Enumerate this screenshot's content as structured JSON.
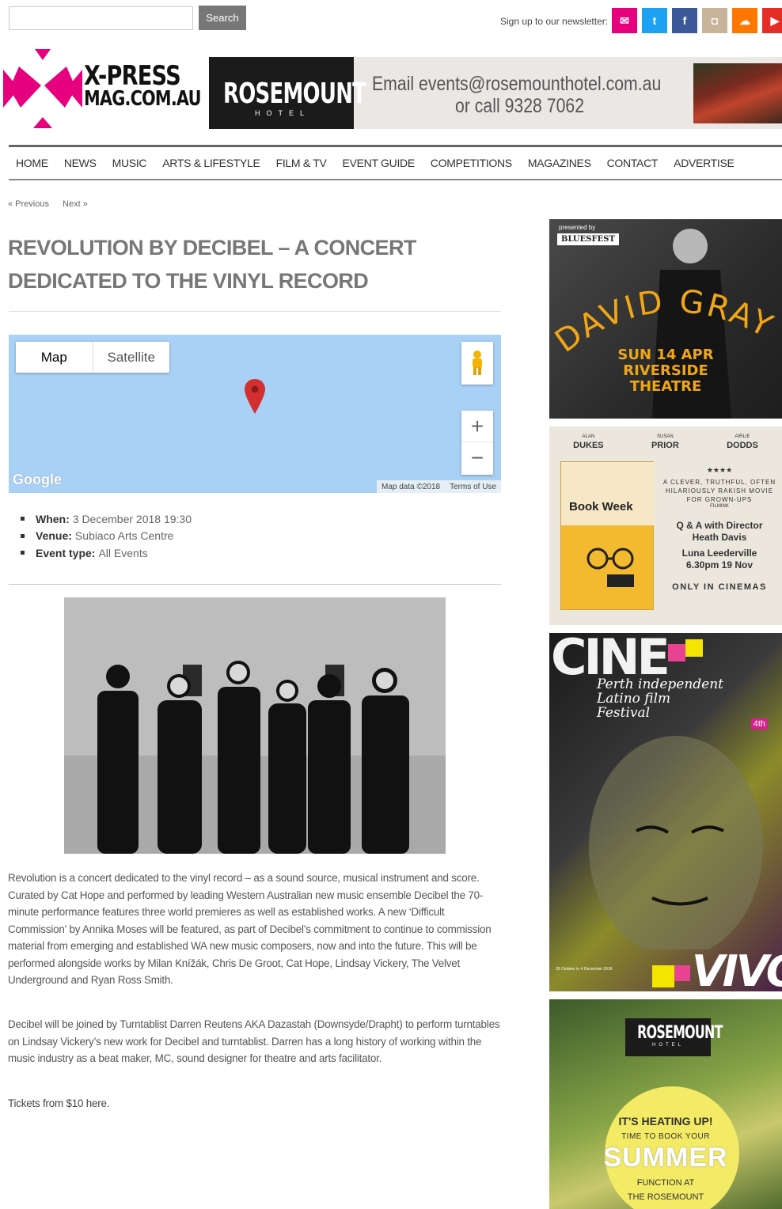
{
  "header": {
    "search_placeholder": "",
    "search_button": "Search",
    "newsletter_label": "Sign up to our newsletter:",
    "social": [
      {
        "name": "email",
        "color": "#e6007e",
        "glyph": "✉"
      },
      {
        "name": "twitter",
        "color": "#1da1f2",
        "glyph": "t"
      },
      {
        "name": "facebook",
        "color": "#3b5998",
        "glyph": "f"
      },
      {
        "name": "instagram",
        "color": "#c8b49a",
        "glyph": "◘"
      },
      {
        "name": "soundcloud",
        "color": "#ff7700",
        "glyph": "☁"
      },
      {
        "name": "youtube",
        "color": "#e52d27",
        "glyph": "▶"
      }
    ]
  },
  "logo": {
    "line1": "X-PRESS",
    "line2": "MAG.COM.AU"
  },
  "banner": {
    "brand": "ROSEMOUNT",
    "brand_sub": "HOTEL",
    "line1": "Email events@rosemounthotel.com.au",
    "line2": "or call 9328 7062"
  },
  "nav": [
    "HOME",
    "NEWS",
    "MUSIC",
    "ARTS & LIFESTYLE",
    "FILM & TV",
    "EVENT GUIDE",
    "COMPETITIONS",
    "MAGAZINES",
    "CONTACT",
    "ADVERTISE"
  ],
  "pager": {
    "previous": "« Previous",
    "next": "Next »"
  },
  "article": {
    "title": "REVOLUTION BY DECIBEL – A CONCERT DEDICATED TO THE VINYL RECORD",
    "map": {
      "tab_map": "Map",
      "tab_satellite": "Satellite",
      "google": "Google",
      "map_data": "Map data ©2018",
      "terms": "Terms of Use"
    },
    "details": [
      {
        "label": "When:",
        "value": "3 December 2018 19:30"
      },
      {
        "label": "Venue:",
        "value": "Subiaco Arts Centre"
      },
      {
        "label": "Event type:",
        "value": "All Events"
      }
    ],
    "paragraph1": "Revolution is a concert dedicated to the vinyl record – as a sound source, musical instrument and score. Curated by Cat Hope and performed by leading Western Australian new music ensemble Decibel the 70-minute performance features three world premieres as well as established works. A new ‘Difficult Commission’ by Annika Moses will be featured, as part of Decibel’s commitment to continue to commission material from emerging and established WA new music composers, now and into the future. This will be performed alongside works by Milan Knížák, Chris De Groot, Cat Hope, Lindsay Vickery, The Velvet Underground and Ryan Ross Smith.",
    "paragraph2": "Decibel will be joined by Turntablist Darren Reutens AKA Dazastah (Downsyde/Drapht) to perform turntables on Lindsay Vickery’s new work for Decibel and turntablist.  Darren has a long history of working within the music industry as a beat maker, MC, sound designer for theatre and arts facilitator.",
    "tickets": "Tickets from $10 here."
  },
  "ads": {
    "ad1": {
      "presented": "presented by",
      "brand": "BLUESFEST",
      "artist": "DAVID GRAY",
      "line1": "SUN 14 APR",
      "line2": "RIVERSIDE",
      "line3": "THEATRE"
    },
    "ad2": {
      "cast": [
        {
          "first": "ALAN",
          "last": "DUKES"
        },
        {
          "first": "SUSAN",
          "last": "PRIOR"
        },
        {
          "first": "AIRLIE",
          "last": "DODDS"
        }
      ],
      "book_title": "Book Week",
      "stars": "★★★★",
      "quote": "A CLEVER, TRUTHFUL, OFTEN HILARIOUSLY RAKISH MOVIE FOR GROWN-UPS",
      "quote_source": "FILMINK",
      "qa1": "Q & A with Director",
      "qa2": "Heath Davis",
      "venue1": "Luna Leederville",
      "venue2": "6.30pm 19 Nov",
      "only": "ONLY IN CINEMAS"
    },
    "ad3": {
      "title": "CINE",
      "subtitle1": "Perth independent",
      "subtitle2": "Latino film",
      "subtitle3": "Festival",
      "edition": "4th",
      "dates": "26 October to 4 December 2018",
      "footer": "VIVO"
    },
    "ad4": {
      "brand": "ROSEMOUNT",
      "brand_sub": "HOTEL",
      "l1": "IT'S HEATING UP!",
      "l2": "TIME TO BOOK YOUR",
      "l3": "SUMMER",
      "l4": "FUNCTION AT",
      "l5": "THE ROSEMOUNT"
    }
  }
}
